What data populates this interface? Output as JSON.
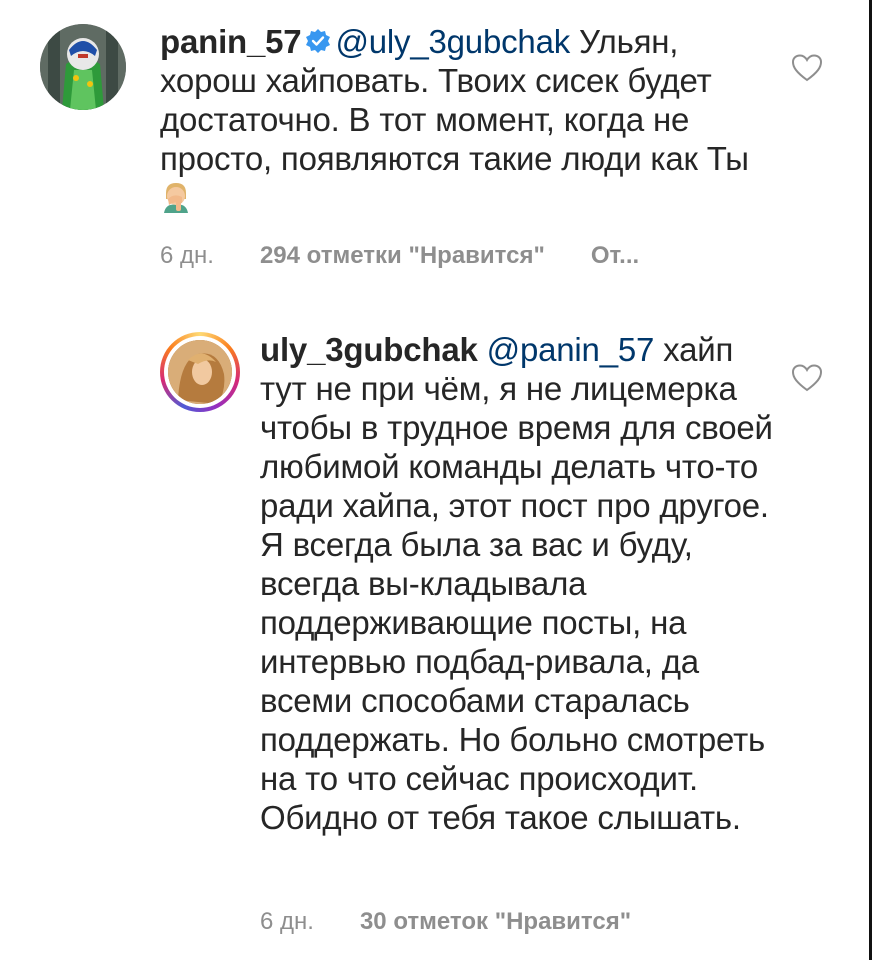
{
  "comments": [
    {
      "username": "panin_57",
      "verified": true,
      "mention": "@uly_3gubchak",
      "text": " Ульян, хорош хайповать. Твоих сисек будет достаточно. В тот момент, когда не просто, появляются такие люди как Ты",
      "emoji": "face-palm-emoji",
      "time": "6 дн.",
      "likes": "294 отметки \"Нравится\"",
      "reply": "От..."
    },
    {
      "username": "uly_3gubchak",
      "verified": false,
      "mention": "@panin_57",
      "text": " хайп тут не при чём, я не лицемерка чтобы в трудное время для своей любимой команды делать что-то ради хайпа, этот пост про другое. Я всегда была за вас и буду, всегда вы-кладывала поддерживающие посты, на интервью подбад-ривала, да всеми способами старалась поддержать. Но больно смотреть на то что сейчас происходит. Обидно от тебя такое слышать.",
      "time": "6 дн.",
      "likes": "30 отметок \"Нравится\""
    }
  ],
  "colors": {
    "text": "#262626",
    "mention": "#00376b",
    "meta": "#8e8e8e",
    "verified": "#3897f0"
  }
}
